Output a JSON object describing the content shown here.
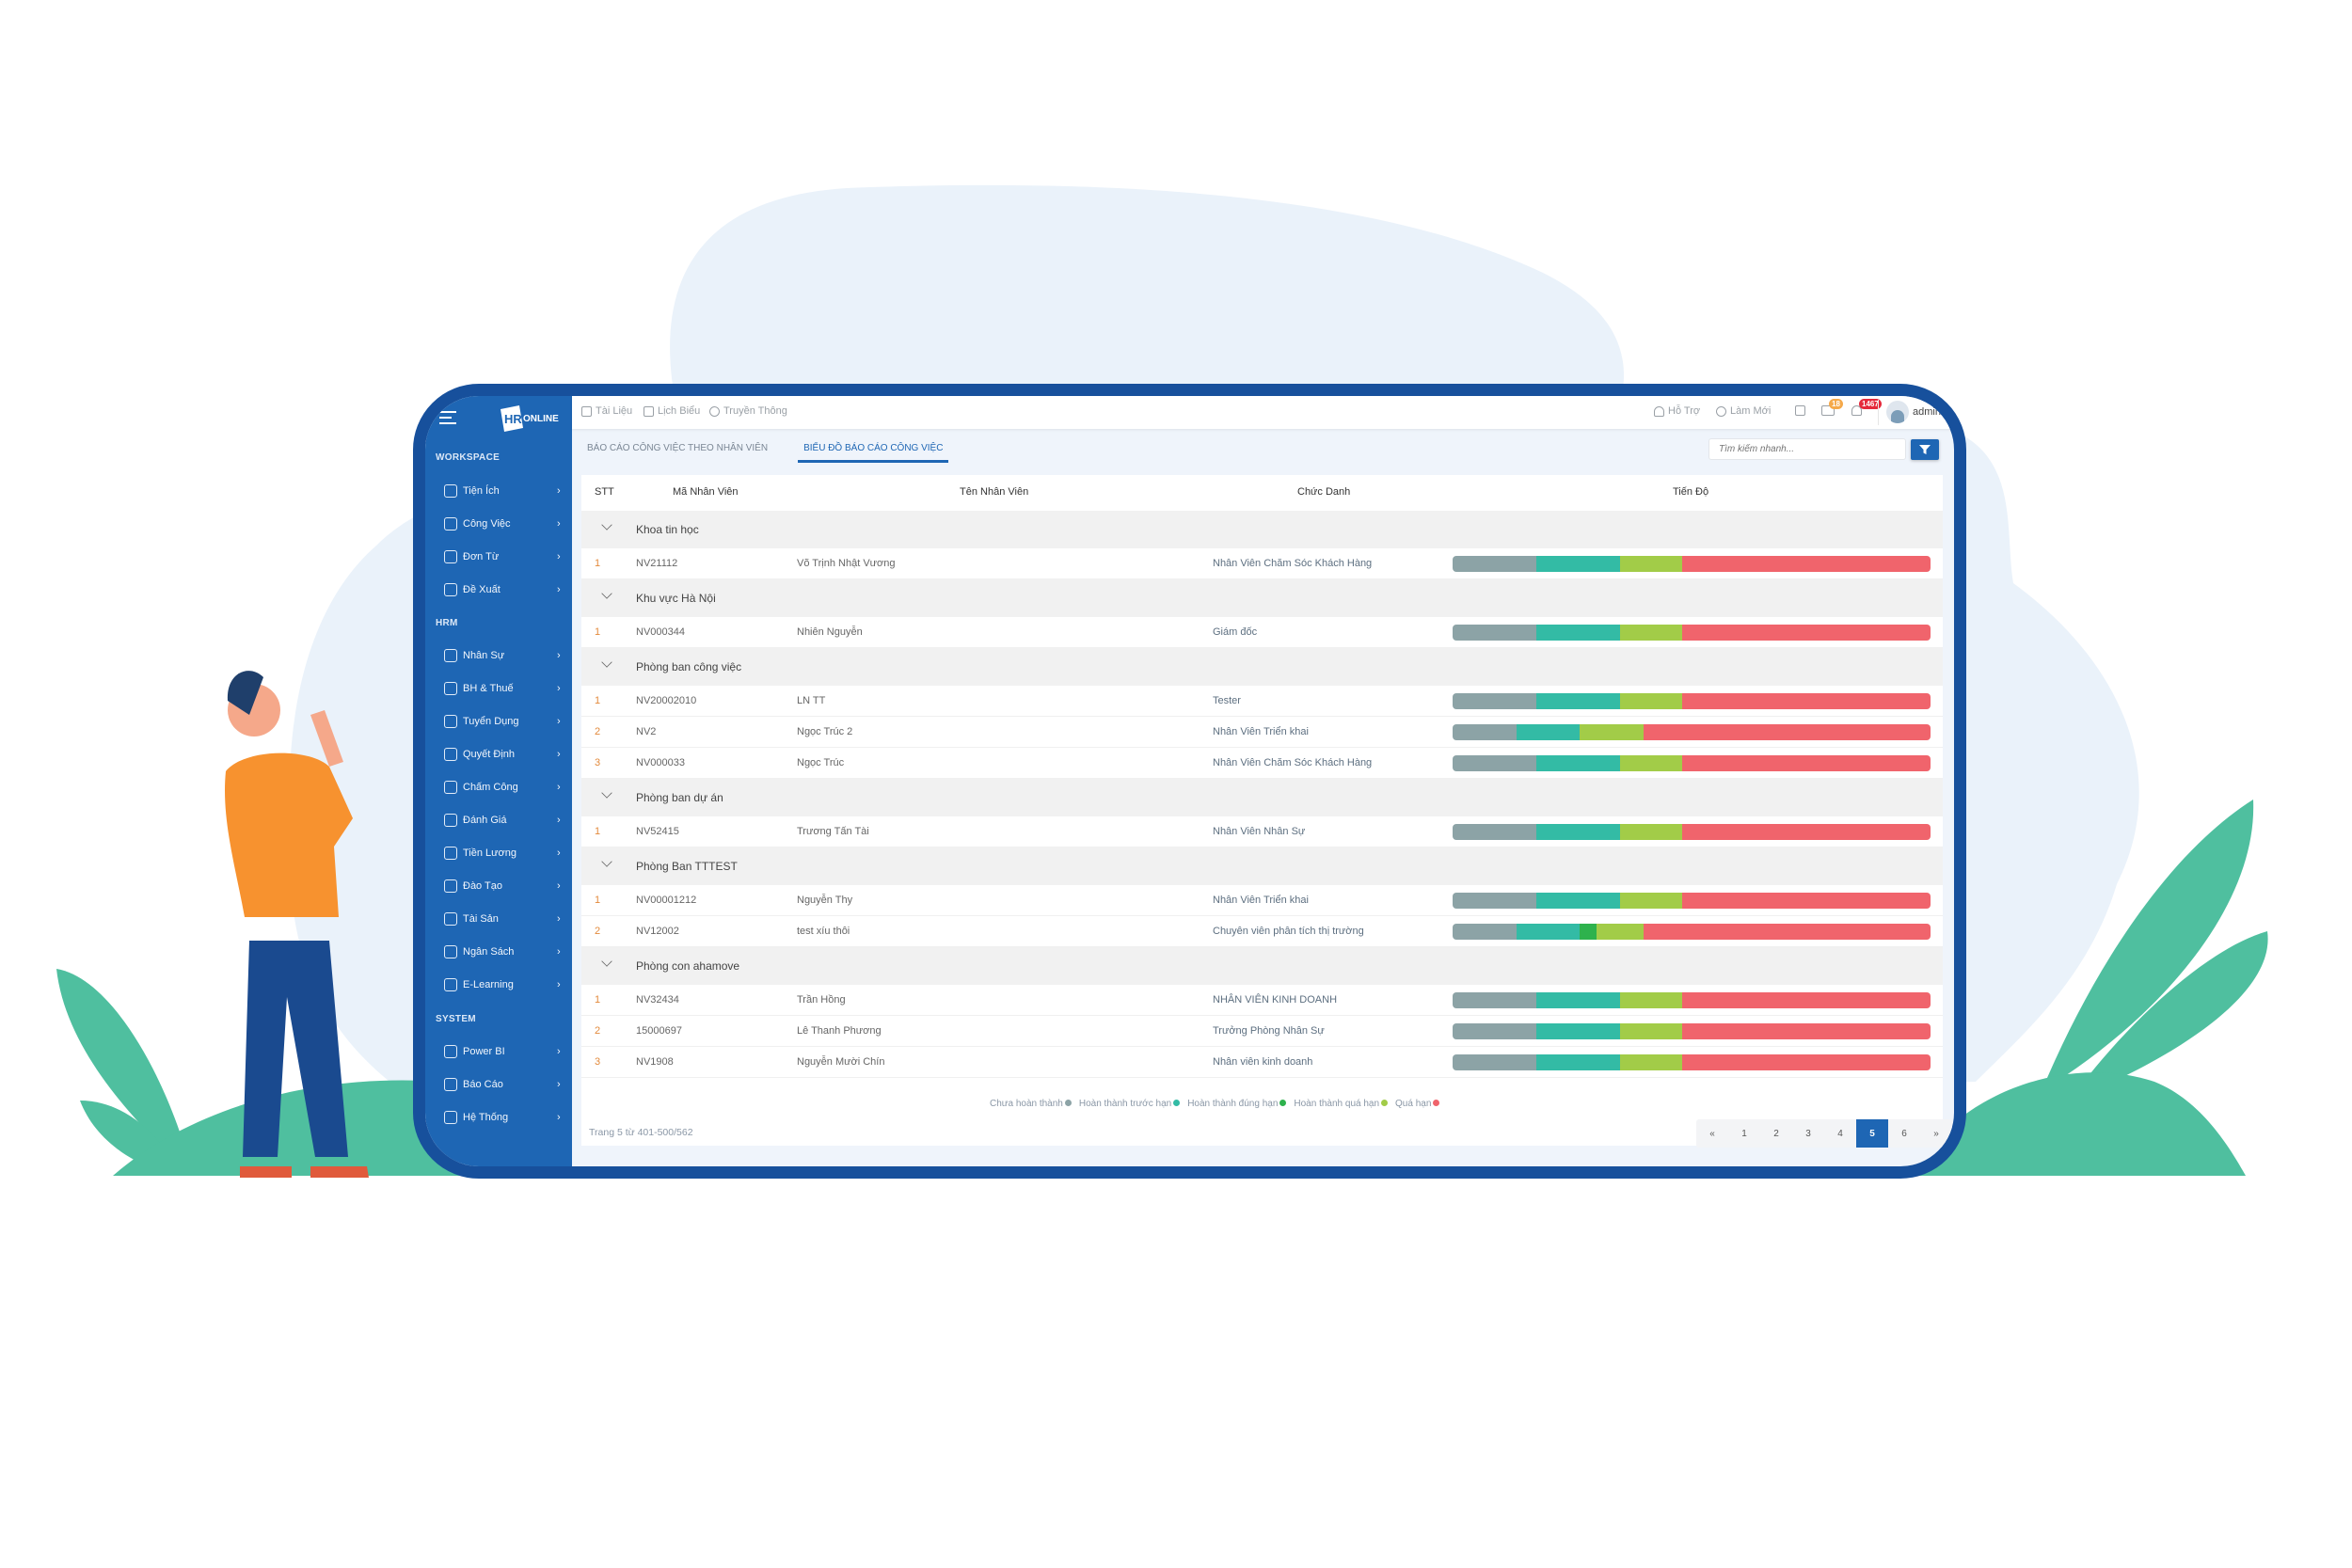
{
  "colors": {
    "accent": "#1e66b4",
    "frame": "#17509c",
    "sidebar": "#1e66b4",
    "plant": "#4fbf9f",
    "blob": "#eaf2fa"
  },
  "logo": {
    "text": "HRONLINE"
  },
  "sidebar": {
    "sections": [
      {
        "label": "WORKSPACE",
        "items": [
          {
            "label": "Tiện Ích",
            "icon": "widgets-icon"
          },
          {
            "label": "Công Việc",
            "icon": "briefcase-icon"
          },
          {
            "label": "Đơn Từ",
            "icon": "document-icon"
          },
          {
            "label": "Đề Xuất",
            "icon": "lightbulb-icon"
          }
        ]
      },
      {
        "label": "HRM",
        "items": [
          {
            "label": "Nhân Sự",
            "icon": "users-icon"
          },
          {
            "label": "BH & Thuế",
            "icon": "wallet-icon"
          },
          {
            "label": "Tuyển Dụng",
            "icon": "user-add-icon"
          },
          {
            "label": "Quyết Định",
            "icon": "decision-icon"
          },
          {
            "label": "Chấm Công",
            "icon": "location-icon"
          },
          {
            "label": "Đánh Giá",
            "icon": "checkbox-icon"
          },
          {
            "label": "Tiền Lương",
            "icon": "dollar-icon"
          },
          {
            "label": "Đào Tạo",
            "icon": "graduation-icon"
          },
          {
            "label": "Tài Sản",
            "icon": "diamond-icon"
          },
          {
            "label": "Ngân Sách",
            "icon": "wallet-icon"
          },
          {
            "label": "E-Learning",
            "icon": "graduation-icon"
          }
        ]
      },
      {
        "label": "SYSTEM",
        "items": [
          {
            "label": "Power BI",
            "icon": "home-chart-icon"
          },
          {
            "label": "Báo Cáo",
            "icon": "bar-chart-icon"
          },
          {
            "label": "Hệ Thống",
            "icon": "gear-icon"
          }
        ]
      }
    ]
  },
  "topbar": {
    "left": [
      {
        "label": "Tài Liệu",
        "icon": "file-icon"
      },
      {
        "label": "Lịch Biểu",
        "icon": "calendar-icon"
      },
      {
        "label": "Truyền Thông",
        "icon": "globe-icon"
      }
    ],
    "support": "Hỗ Trợ",
    "refresh": "Làm Mới",
    "mail_count": "18",
    "notif_count": "1467",
    "user": "admin"
  },
  "tabs": [
    {
      "label": "BÁO CÁO CÔNG VIỆC THEO NHÂN VIÊN",
      "active": false
    },
    {
      "label": "BIỂU ĐỒ BÁO CÁO CÔNG VIỆC",
      "active": true
    }
  ],
  "search": {
    "placeholder": "Tìm kiếm nhanh..."
  },
  "table": {
    "headers": {
      "stt": "STT",
      "code": "Mã Nhân Viên",
      "name": "Tên Nhân Viên",
      "title": "Chức Danh",
      "progress": "Tiến Độ"
    },
    "groups": [
      {
        "name": "Khoa tin học",
        "rows": [
          {
            "stt": "1",
            "code": "NV21112",
            "name": "Võ Trịnh Nhật Vương",
            "title": "Nhân Viên Chăm Sóc Khách Hàng",
            "progress": [
              17.5,
              17.5,
              0,
              13,
              52
            ]
          }
        ]
      },
      {
        "name": "Khu vực Hà Nội",
        "rows": [
          {
            "stt": "1",
            "code": "NV000344",
            "name": "Nhiên Nguyễn",
            "title": "Giám đốc",
            "progress": [
              17.5,
              17.5,
              0,
              13,
              52
            ]
          }
        ]
      },
      {
        "name": "Phòng ban công việc",
        "rows": [
          {
            "stt": "1",
            "code": "NV20002010",
            "name": "LN TT",
            "title": "Tester",
            "progress": [
              17.5,
              17.5,
              0,
              13,
              52
            ]
          },
          {
            "stt": "2",
            "code": "NV2",
            "name": "Ngọc Trúc 2",
            "title": "Nhân Viên Triển khai",
            "progress": [
              13.3,
              13.3,
              0,
              13.3,
              60.1
            ]
          },
          {
            "stt": "3",
            "code": "NV000033",
            "name": "Ngọc Trúc",
            "title": "Nhân Viên Chăm Sóc Khách Hàng",
            "progress": [
              17.5,
              17.5,
              0,
              13,
              52
            ]
          }
        ]
      },
      {
        "name": "Phòng ban dự án",
        "rows": [
          {
            "stt": "1",
            "code": "NV52415",
            "name": "Trương Tấn Tài",
            "title": "Nhân Viên Nhân Sự",
            "progress": [
              17.5,
              17.5,
              0,
              13,
              52
            ]
          }
        ]
      },
      {
        "name": "Phòng Ban TTTEST",
        "rows": [
          {
            "stt": "1",
            "code": "NV00001212",
            "name": "Nguyễn Thy",
            "title": "Nhân Viên Triển khai",
            "progress": [
              17.5,
              17.5,
              0,
              13,
              52
            ]
          },
          {
            "stt": "2",
            "code": "NV12002",
            "name": "test xíu thôi",
            "title": "Chuyên viên phân tích thị trường",
            "progress": [
              13.3,
              13.3,
              3.5,
              9.8,
              60.1
            ]
          }
        ]
      },
      {
        "name": "Phòng con ahamove",
        "rows": [
          {
            "stt": "1",
            "code": "NV32434",
            "name": "Trần Hồng",
            "title": "NHÂN VIÊN KINH DOANH",
            "progress": [
              17.5,
              17.5,
              0,
              13,
              52
            ]
          },
          {
            "stt": "2",
            "code": "15000697",
            "name": "Lê Thanh Phương",
            "title": "Trưởng Phòng Nhân Sự",
            "progress": [
              17.5,
              17.5,
              0,
              13,
              52
            ]
          },
          {
            "stt": "3",
            "code": "NV1908",
            "name": "Nguyễn Mười Chín",
            "title": "Nhân viên kinh doanh",
            "progress": [
              17.5,
              17.5,
              0,
              13,
              52
            ]
          }
        ]
      }
    ]
  },
  "legend": [
    {
      "label": "Chưa hoàn thành",
      "color": "#8ca3a6"
    },
    {
      "label": "Hoàn thành trước hạn",
      "color": "#33bba5"
    },
    {
      "label": "Hoàn thành đúng hạn",
      "color": "#2eb24d"
    },
    {
      "label": "Hoàn thành quá hạn",
      "color": "#a2cc48"
    },
    {
      "label": "Quá hạn",
      "color": "#f0646c"
    }
  ],
  "footer": {
    "page_info": "Trang 5 từ 401-500/562"
  },
  "pagination": {
    "items": [
      "«",
      "1",
      "2",
      "3",
      "4",
      "5",
      "6",
      "»"
    ],
    "active": "5"
  }
}
